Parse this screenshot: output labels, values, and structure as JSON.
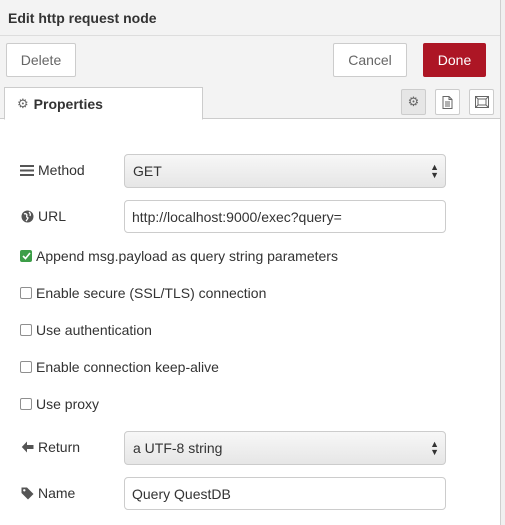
{
  "tray": {
    "title": "Edit http request node"
  },
  "toolbar": {
    "delete_label": "Delete",
    "cancel_label": "Cancel",
    "done_label": "Done"
  },
  "tabs": {
    "properties_label": "Properties"
  },
  "form": {
    "method": {
      "label": "Method",
      "value": "GET"
    },
    "url": {
      "label": "URL",
      "value": "http://localhost:9000/exec?query="
    },
    "checkboxes": [
      {
        "label": "Append msg.payload as query string parameters",
        "checked": true
      },
      {
        "label": "Enable secure (SSL/TLS) connection",
        "checked": false
      },
      {
        "label": "Use authentication",
        "checked": false
      },
      {
        "label": "Enable connection keep-alive",
        "checked": false
      },
      {
        "label": "Use proxy",
        "checked": false
      }
    ],
    "ret": {
      "label": "Return",
      "value": "a UTF-8 string"
    },
    "name": {
      "label": "Name",
      "value": "Query QuestDB"
    }
  },
  "colors": {
    "done_button": "#ad1625",
    "checkbox_checked": "#3d9e48",
    "header_bg": "#f3f3f3"
  }
}
